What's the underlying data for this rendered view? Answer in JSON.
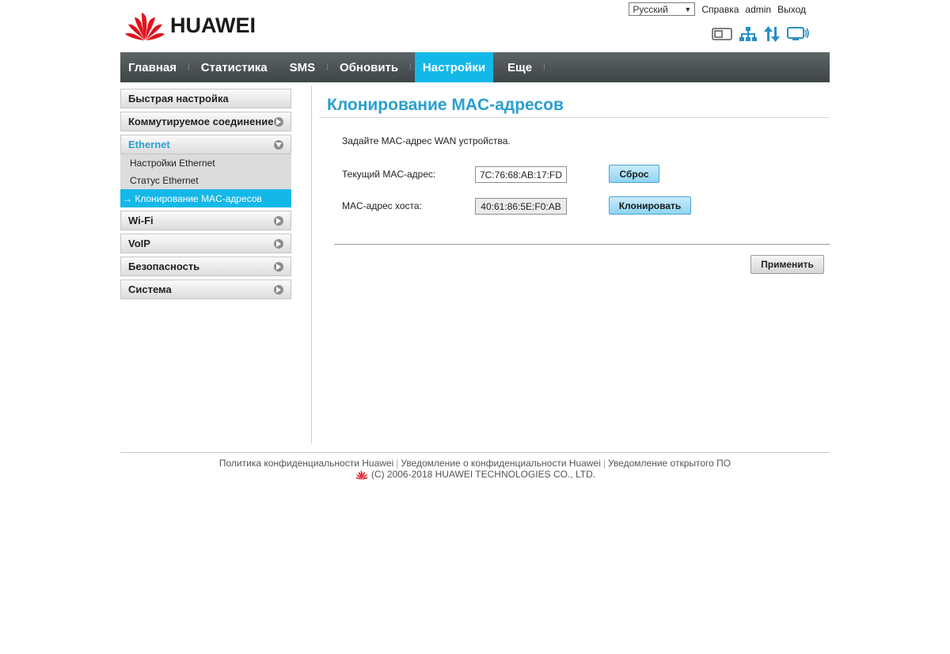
{
  "header": {
    "brand": "HUAWEI",
    "language": "Русский",
    "links": {
      "help": "Справка",
      "user": "admin",
      "logout": "Выход"
    },
    "status_icons": [
      "sim-icon",
      "network-icon",
      "data-transfer-icon",
      "wifi-monitor-icon"
    ]
  },
  "nav": {
    "items": [
      {
        "label": "Главная"
      },
      {
        "label": "Статистика"
      },
      {
        "label": "SMS"
      },
      {
        "label": "Обновить"
      },
      {
        "label": "Настройки",
        "active": true
      },
      {
        "label": "Еще"
      }
    ]
  },
  "sidebar": {
    "items": [
      {
        "label": "Быстрая настройка"
      },
      {
        "label": "Коммутируемое соединение"
      },
      {
        "label": "Ethernet",
        "expanded": true,
        "children": [
          {
            "label": "Настройки Ethernet"
          },
          {
            "label": "Статус Ethernet"
          },
          {
            "label": "→ Клонирование MAC-адресов",
            "active": true
          }
        ]
      },
      {
        "label": "Wi-Fi"
      },
      {
        "label": "VoIP"
      },
      {
        "label": "Безопасность"
      },
      {
        "label": "Система"
      }
    ]
  },
  "main": {
    "title": "Клонирование MAC-адресов",
    "description": "Задайте MAC-адрес WAN устройства.",
    "current_mac": {
      "label": "Текущий MAC-адрес:",
      "value": "7C:76:68:AB:17:FD",
      "button": "Сброс"
    },
    "host_mac": {
      "label": "MAC-адрес хоста:",
      "value": "40:61:86:5E:F0:AB",
      "button": "Клонировать"
    },
    "apply_button": "Применить"
  },
  "footer": {
    "links": [
      "Политика конфиденциальности Huawei",
      "Уведомление о конфиденциальности Huawei",
      "Уведомление открытого ПО"
    ],
    "copyright": "(C) 2006-2018 HUAWEI TECHNOLOGIES CO., LTD."
  },
  "colors": {
    "accent": "#14b8e8",
    "title": "#2a9fd0",
    "brand_red": "#e0141e"
  }
}
